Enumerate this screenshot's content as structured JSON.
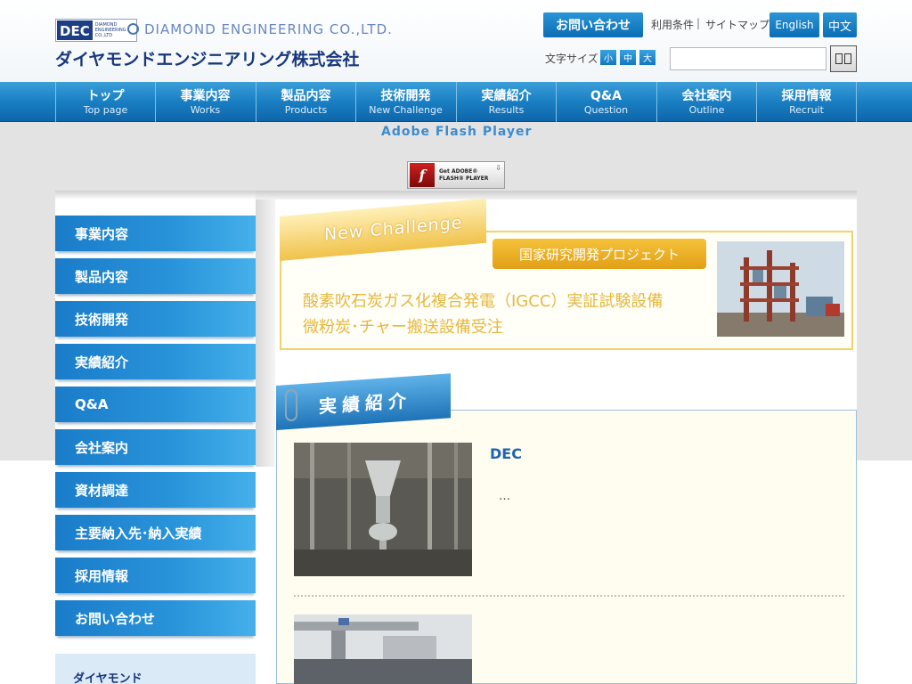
{
  "header": {
    "logo_mark": "DEC",
    "logo_mark_small": "DIAMOND ENGINEERING CO.,LTD",
    "logo_en": "DIAMOND ENGINEERING CO.,LTD.",
    "logo_jp": "ダイヤモンドエンジニアリング株式会社",
    "contact_label": "お問い合わせ",
    "terms_label": "利用条件",
    "separator": "|",
    "sitemap_label": "サイトマップ",
    "lang_en": "English",
    "lang_zh": "中文",
    "fontsize_label": "文字サイズ",
    "fontsize_small": "小",
    "fontsize_medium": "中",
    "fontsize_large": "大",
    "search_value": ""
  },
  "nav": [
    {
      "jp": "トップ",
      "en": "Top page"
    },
    {
      "jp": "事業内容",
      "en": "Works"
    },
    {
      "jp": "製品内容",
      "en": "Products"
    },
    {
      "jp": "技術開発",
      "en": "New Challenge"
    },
    {
      "jp": "実績紹介",
      "en": "Results"
    },
    {
      "jp": "Q&A",
      "en": "Question"
    },
    {
      "jp": "会社案内",
      "en": "Outline"
    },
    {
      "jp": "採用情報",
      "en": "Recruit"
    }
  ],
  "flash": {
    "title": "Adobe Flash Player",
    "badge_line1": "Get ADOBE®",
    "badge_line2": "FLASH® PLAYER"
  },
  "sidebar": {
    "items": [
      "事業内容",
      "製品内容",
      "技術開発",
      "実績紹介",
      "Q&A",
      "会社案内",
      "資材調達",
      "主要納入先･納入実績",
      "採用情報",
      "お問い合わせ"
    ],
    "banner_text": "ダイヤモンド"
  },
  "new_challenge": {
    "ribbon": "New Challenge",
    "tag": "国家研究開発プロジェクト",
    "line1": "酸素吹石炭ガス化複合発電（IGCC）実証試験設備",
    "line2": "微粉炭･チャー搬送設備受注"
  },
  "results": {
    "ribbon": "実績紹介",
    "item1_title": "DEC",
    "item1_desc": "…"
  },
  "colors": {
    "nav_blue": "#1a7fc3",
    "accent_gold": "#f0c24a",
    "link_blue": "#1f63b0"
  }
}
